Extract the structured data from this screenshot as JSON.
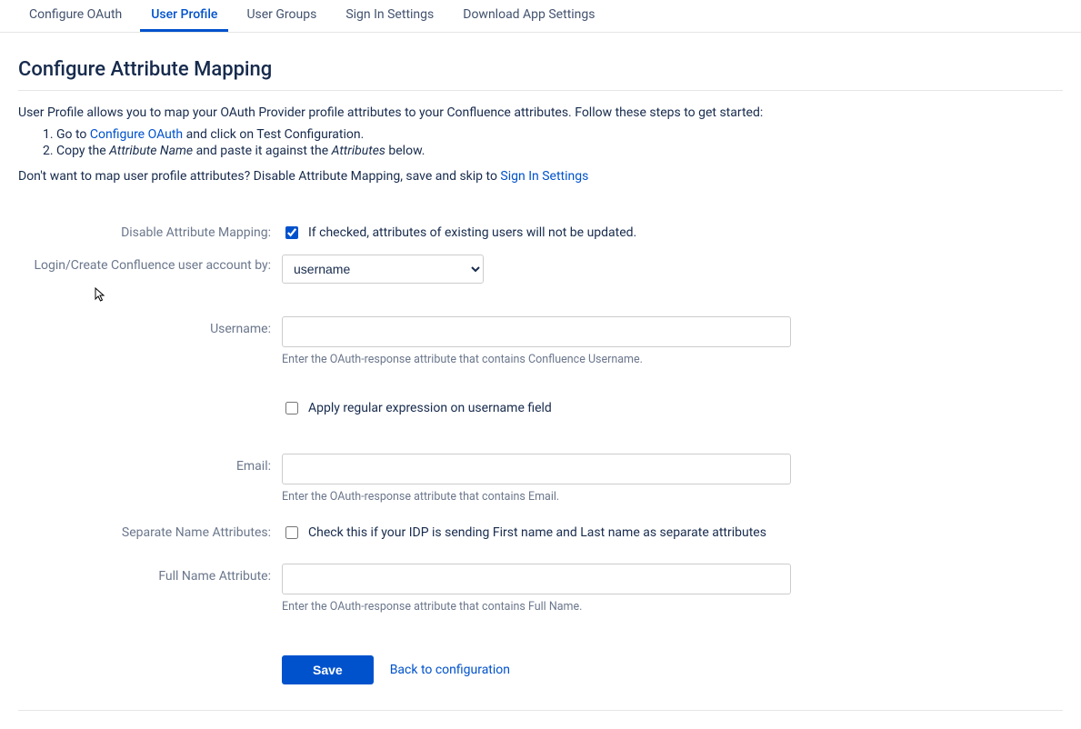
{
  "tabs": {
    "items": [
      "Configure OAuth",
      "User Profile",
      "User Groups",
      "Sign In Settings",
      "Download App Settings"
    ],
    "active_index": 1
  },
  "page_title": "Configure Attribute Mapping",
  "intro_text": "User Profile allows you to map your OAuth Provider profile attributes to your Confluence attributes. Follow these steps to get started:",
  "steps": {
    "s1_a": "Go to ",
    "s1_link": "Configure OAuth",
    "s1_b": " and click on Test Configuration.",
    "s2_a": "Copy the ",
    "s2_em1": "Attribute Name",
    "s2_b": " and paste it against the ",
    "s2_em2": "Attributes",
    "s2_c": " below."
  },
  "skip": {
    "pre": "Don't want to map user profile attributes? Disable Attribute Mapping, save and skip to ",
    "link": "Sign In Settings"
  },
  "form": {
    "disable_mapping": {
      "label": "Disable Attribute Mapping:",
      "cb_text": "If checked, attributes of existing users will not be updated.",
      "checked": true
    },
    "login_by": {
      "label": "Login/Create Confluence user account by:",
      "selected": "username",
      "options": [
        "username"
      ]
    },
    "username": {
      "label": "Username:",
      "value": "",
      "help": "Enter the OAuth-response attribute that contains Confluence Username."
    },
    "regex": {
      "cb_text": "Apply regular expression on username field",
      "checked": false
    },
    "email": {
      "label": "Email:",
      "value": "",
      "help": "Enter the OAuth-response attribute that contains Email."
    },
    "separate_name": {
      "label": "Separate Name Attributes:",
      "cb_text": "Check this if your IDP is sending First name and Last name as separate attributes",
      "checked": false
    },
    "full_name": {
      "label": "Full Name Attribute:",
      "value": "",
      "help": "Enter the OAuth-response attribute that contains Full Name."
    }
  },
  "actions": {
    "save": "Save",
    "back": "Back to configuration"
  }
}
